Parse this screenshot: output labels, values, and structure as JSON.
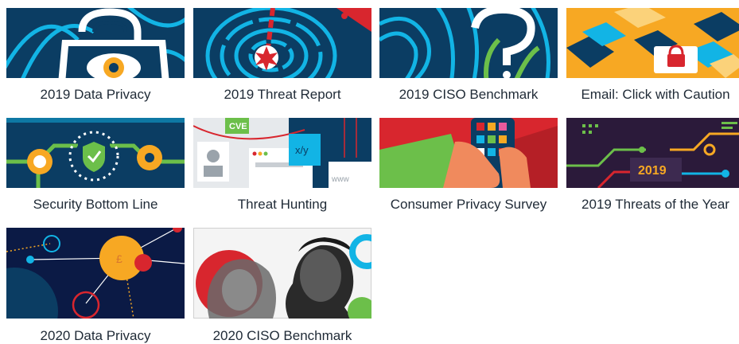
{
  "tiles": [
    {
      "label": "2019 Data Privacy"
    },
    {
      "label": "2019 Threat Report"
    },
    {
      "label": "2019 CISO Benchmark"
    },
    {
      "label": "Email: Click with Caution"
    },
    {
      "label": "Security Bottom Line"
    },
    {
      "label": "Threat Hunting"
    },
    {
      "label": "Consumer Privacy Survey"
    },
    {
      "label": "2019 Threats of the Year"
    },
    {
      "label": "2020 Data Privacy"
    },
    {
      "label": "2020 CISO Benchmark"
    }
  ],
  "thumb_text": {
    "cve": "CVE",
    "year_2019": "2019",
    "pound": "£",
    "www": "www"
  },
  "icons": [
    "lock-eye-icon",
    "fingerprint-target-icon",
    "fingerprint-question-icon",
    "envelope-lock-icon",
    "shield-network-icon",
    "browser-windows-icon",
    "phone-hand-icon",
    "circuit-board-icon",
    "planet-network-icon",
    "portrait-lion-icon"
  ],
  "colors": {
    "caption": "#1f2a36",
    "navy": "#0b3d63",
    "teal": "#12b4e5",
    "green": "#6cbf4a",
    "orange": "#f7a823",
    "red": "#d8262e"
  }
}
